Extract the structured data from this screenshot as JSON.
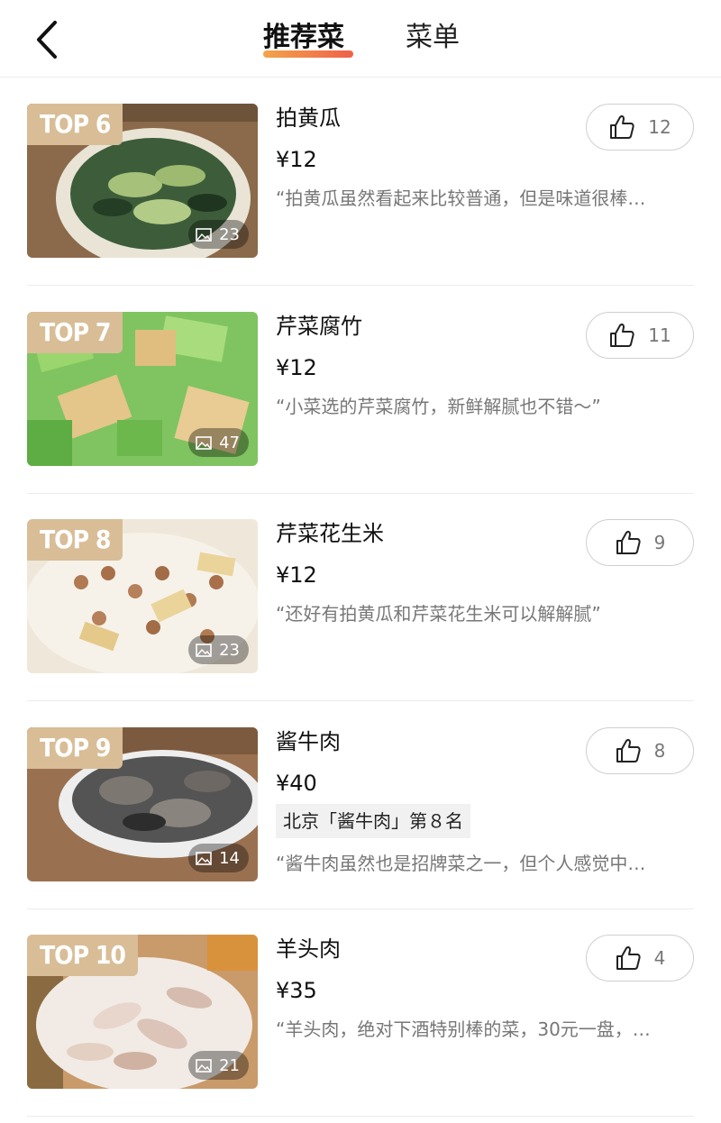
{
  "header": {
    "tabs": [
      {
        "label": "推荐菜",
        "active": true
      },
      {
        "label": "菜单",
        "active": false
      }
    ]
  },
  "dishes": [
    {
      "rank": "TOP 6",
      "name": "拍黄瓜",
      "price": "¥12",
      "photos": "23",
      "likes": "12",
      "ranking_tag": "",
      "quote": "“拍黄瓜虽然看起来比较普通，但是味道很棒…"
    },
    {
      "rank": "TOP 7",
      "name": "芹菜腐竹",
      "price": "¥12",
      "photos": "47",
      "likes": "11",
      "ranking_tag": "",
      "quote": "“小菜选的芹菜腐竹，新鲜解腻也不错～”"
    },
    {
      "rank": "TOP 8",
      "name": "芹菜花生米",
      "price": "¥12",
      "photos": "23",
      "likes": "9",
      "ranking_tag": "",
      "quote": "“还好有拍黄瓜和芹菜花生米可以解解腻”"
    },
    {
      "rank": "TOP 9",
      "name": "酱牛肉",
      "price": "¥40",
      "photos": "14",
      "likes": "8",
      "ranking_tag": "北京「酱牛肉」第８名",
      "quote": "“酱牛肉虽然也是招牌菜之一，但个人感觉中…"
    },
    {
      "rank": "TOP 10",
      "name": "羊头肉",
      "price": "¥35",
      "photos": "21",
      "likes": "4",
      "ranking_tag": "",
      "quote": "“羊头肉，绝对下酒特别棒的菜，30元一盘，…"
    }
  ],
  "colors": {
    "rank_badge": "#d8bd97",
    "tab_underline_start": "#f3a44b",
    "tab_underline_end": "#f0604a"
  },
  "icons": {
    "back": "chevron-left-icon",
    "like": "thumbs-up-icon",
    "photo": "image-icon"
  }
}
